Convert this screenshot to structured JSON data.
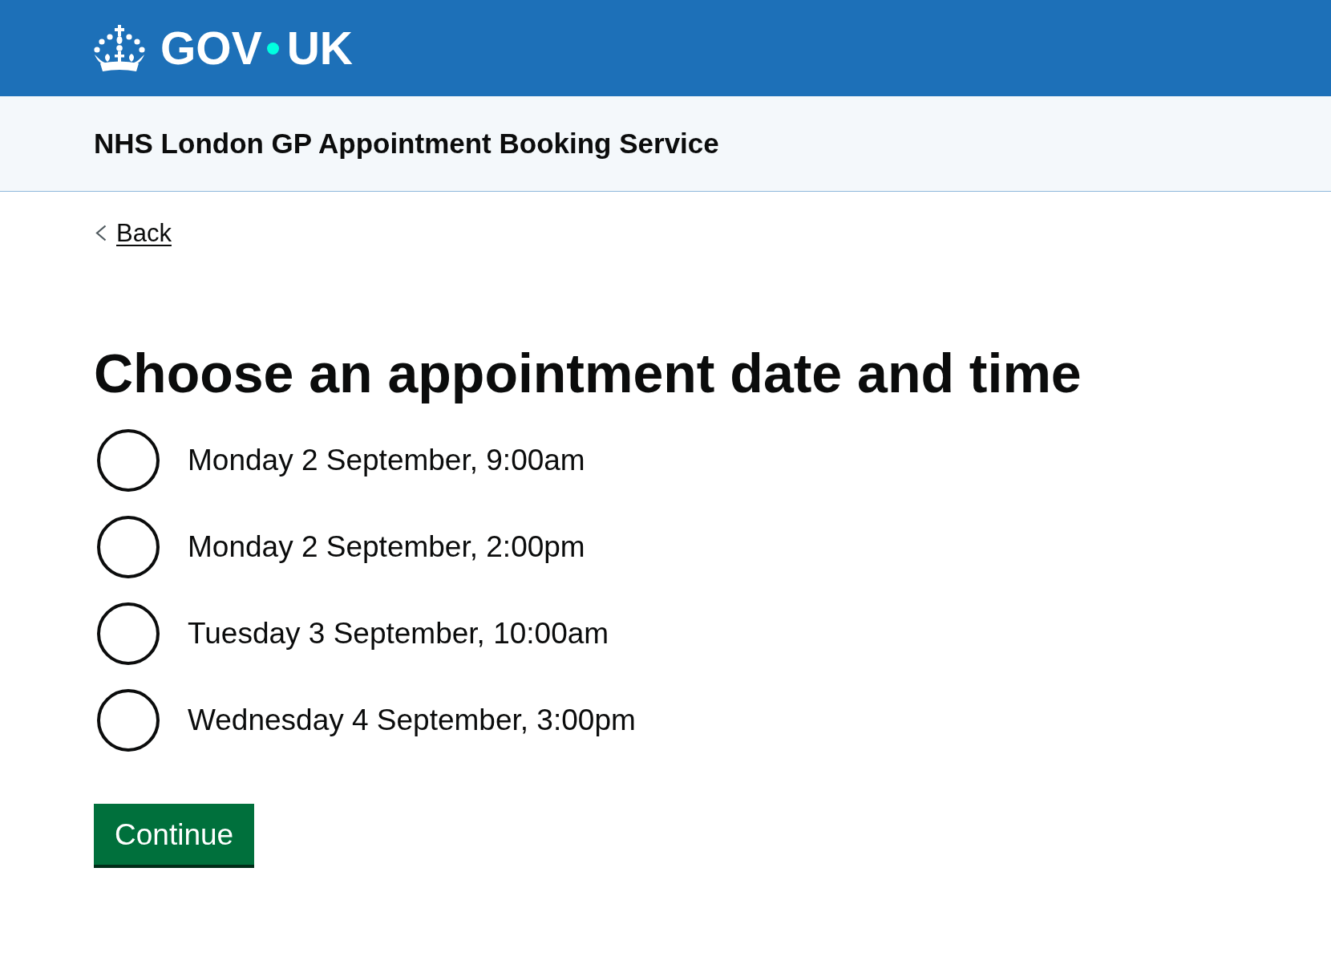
{
  "header": {
    "logo": {
      "left": "GOV",
      "right": "UK"
    }
  },
  "service_name": "NHS London GP Appointment Booking Service",
  "back_link": "Back",
  "heading": "Choose an appointment date and time",
  "options": [
    {
      "label": "Monday 2 September, 9:00am",
      "selected": false
    },
    {
      "label": "Monday 2 September, 2:00pm",
      "selected": false
    },
    {
      "label": "Tuesday 3 September, 10:00am",
      "selected": false
    },
    {
      "label": "Wednesday 4 September, 3:00pm",
      "selected": false
    }
  ],
  "button": "Continue"
}
